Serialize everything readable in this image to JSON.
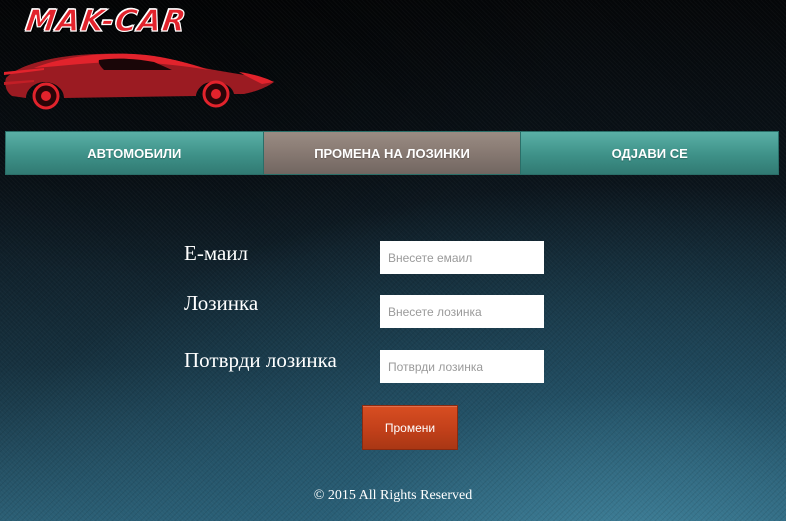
{
  "logo": {
    "text": "MAK-CAR",
    "colors": {
      "primary": "#e2232c",
      "dark": "#7a0f14",
      "accent": "#ffffff"
    }
  },
  "nav": {
    "tabs": [
      {
        "label": "АВТОМОБИЛИ",
        "active": false
      },
      {
        "label": "ПРОМЕНА НА ЛОЗИНКИ",
        "active": true
      },
      {
        "label": "ОДЈАВИ СЕ",
        "active": false
      }
    ],
    "colors": {
      "tab": "#3e9188",
      "active": "#857770"
    }
  },
  "form": {
    "email": {
      "label": "E-маил",
      "placeholder": "Внесете емаил",
      "value": ""
    },
    "password": {
      "label": "Лозинка",
      "placeholder": "Внесете лозинка",
      "value": ""
    },
    "confirm": {
      "label": "Потврди лозинка",
      "placeholder": "Потврди лозинка",
      "value": ""
    },
    "submit_label": "Промени",
    "submit_color": "#c2401a"
  },
  "footer": {
    "text": "© 2015 All Rights Reserved"
  }
}
